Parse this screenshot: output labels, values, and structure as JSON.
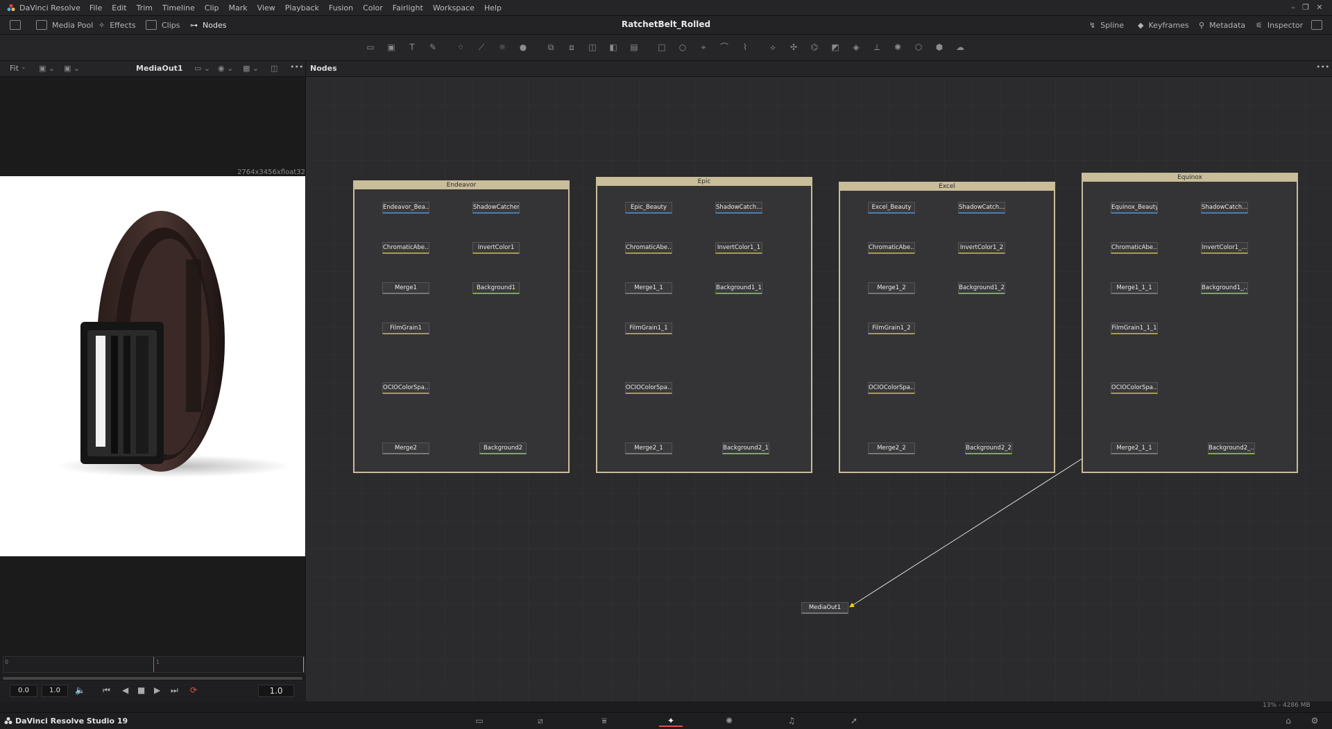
{
  "app": {
    "name": "DaVinci Resolve",
    "brand": "DaVinci Resolve Studio 19"
  },
  "menu": [
    "File",
    "Edit",
    "Trim",
    "Timeline",
    "Clip",
    "Mark",
    "View",
    "Playback",
    "Fusion",
    "Color",
    "Fairlight",
    "Workspace",
    "Help"
  ],
  "project_title": "RatchetBelt_Rolled",
  "toolbar_left": [
    "Media Pool",
    "Effects",
    "Clips",
    "Nodes"
  ],
  "toolbar_right": [
    "Spline",
    "Keyframes",
    "Metadata",
    "Inspector"
  ],
  "viewer": {
    "fit": "Fit",
    "name": "MediaOut1",
    "resolution": "2764x3456xfloat32"
  },
  "nodes_header": "Nodes",
  "transport": {
    "start": "0.0",
    "end": "1.0",
    "current": "1.0",
    "marker_a": "0",
    "marker_b": "1"
  },
  "groups": [
    {
      "title": "Endeavor",
      "nodes": {
        "source": "Endeavor_Bea...",
        "shadow": "ShadowCatcher",
        "chroma": "ChromaticAbe...",
        "invert": "InvertColor1",
        "merge1": "Merge1",
        "bg1": "Background1",
        "grain": "FilmGrain1",
        "ocio": "OCIOColorSpa...",
        "merge2": "Merge2",
        "bg2": "Background2"
      }
    },
    {
      "title": "Epic",
      "nodes": {
        "source": "Epic_Beauty",
        "shadow": "ShadowCatch...",
        "chroma": "ChromaticAbe...",
        "invert": "InvertColor1_1",
        "merge1": "Merge1_1",
        "bg1": "Background1_1",
        "grain": "FilmGrain1_1",
        "ocio": "OCIOColorSpa...",
        "merge2": "Merge2_1",
        "bg2": "Background2_1"
      }
    },
    {
      "title": "Excel",
      "nodes": {
        "source": "Excel_Beauty",
        "shadow": "ShadowCatch...",
        "chroma": "ChromaticAbe...",
        "invert": "InvertColor1_2",
        "merge1": "Merge1_2",
        "bg1": "Background1_2",
        "grain": "FilmGrain1_2",
        "ocio": "OCIOColorSpa...",
        "merge2": "Merge2_2",
        "bg2": "Background2_2"
      }
    },
    {
      "title": "Equinox",
      "nodes": {
        "source": "Equinox_Beauty",
        "shadow": "ShadowCatch...",
        "chroma": "ChromaticAbe...",
        "invert": "InvertColor1_...",
        "merge1": "Merge1_1_1",
        "bg1": "Background1_...",
        "grain": "FilmGrain1_1_1",
        "ocio": "OCIOColorSpa...",
        "merge2": "Merge2_1_1",
        "bg2": "Background2_..."
      }
    }
  ],
  "media_out": "MediaOut1",
  "memory": "13% - 4286 MB",
  "colors": {
    "group_border": "#c9bd9a",
    "link": "#d9d9d9",
    "yellow_arrow": "#e8c000",
    "blue_arrow": "#4aa8e8",
    "green_arrow": "#8fd14f",
    "loop_red": "#e05050"
  }
}
